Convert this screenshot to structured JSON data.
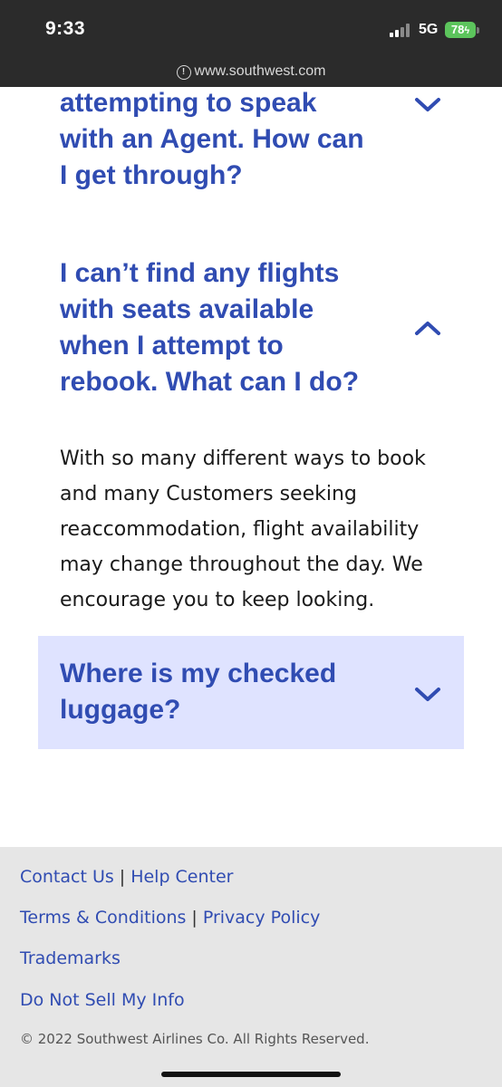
{
  "status_bar": {
    "time": "9:33",
    "network": "5G",
    "battery": "78"
  },
  "browser": {
    "url": "www.southwest.com"
  },
  "faq": {
    "items": [
      {
        "question": "attempting to speak\nwith an Agent. How can\nI get through?",
        "expanded": false
      },
      {
        "question": "I can’t find any flights\nwith seats available\nwhen I attempt to\nrebook. What can I do?",
        "expanded": true,
        "answer": "With so many different ways to book\nand many Customers seeking\nreaccommodation, flight availability\nmay change throughout the day. We\nencourage you to keep looking."
      },
      {
        "question": "Where is my checked\nluggage?",
        "expanded": false
      }
    ]
  },
  "footer": {
    "contact_us": "Contact Us",
    "help_center": "Help Center",
    "terms": "Terms & Conditions",
    "privacy": "Privacy Policy",
    "trademarks": "Trademarks",
    "do_not_sell": "Do Not Sell My Info",
    "separator": "|",
    "copyright": "© 2022 Southwest Airlines Co. All Rights Reserved."
  },
  "icons": {
    "chevron_down": "chevron-down-icon",
    "chevron_up": "chevron-up-icon",
    "info": "info-icon"
  },
  "colors": {
    "brand_blue": "#304cb2",
    "highlight_bg": "#dfe3ff",
    "footer_bg": "#e6e6e6",
    "status_bar_bg": "#2b2b2b"
  }
}
